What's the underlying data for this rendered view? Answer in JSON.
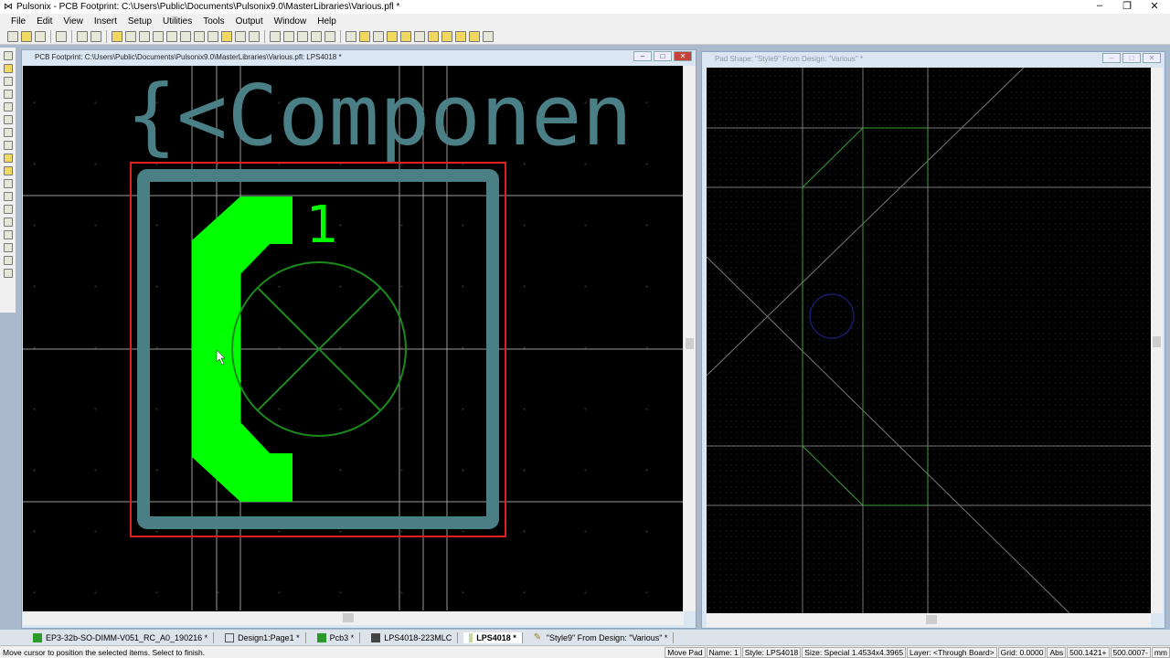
{
  "app": {
    "title": "Pulsonix - PCB Footprint: C:\\Users\\Public\\Documents\\Pulsonix9.0\\MasterLibraries\\Various.pfl *",
    "controls": [
      "–",
      "❐",
      "✕"
    ]
  },
  "menu": [
    "File",
    "Edit",
    "View",
    "Insert",
    "Setup",
    "Utilities",
    "Tools",
    "Output",
    "Window",
    "Help"
  ],
  "left_window": {
    "title": "PCB Footprint: C:\\Users\\Public\\Documents\\Pulsonix9.0\\MasterLibraries\\Various.pfl: LPS4018 *",
    "component_text": "{<Componen",
    "pad_number": "1"
  },
  "right_window": {
    "title": "Pad Shape: \"Style9\"  From Design: \"Various\" *"
  },
  "tabs": [
    {
      "label": "EP3-32b-SO-DIMM-V051_RC_A0_190216 *",
      "icon": "pcb-icon"
    },
    {
      "label": "Design1:Page1 *",
      "icon": "schematic-icon"
    },
    {
      "label": "Pcb3 *",
      "icon": "pcb-icon"
    },
    {
      "label": "LPS4018-223MLC",
      "icon": "footprint-icon"
    },
    {
      "label": "LPS4018 *",
      "icon": "footprint-icon",
      "active": true
    },
    {
      "label": "\"Style9\"  From Design: \"Various\" *",
      "icon": "pad-style-icon"
    }
  ],
  "status": {
    "message": "Move cursor to position the selected items. Select to finish.",
    "cells": [
      "Move Pad",
      "Name: 1",
      "Style: LPS4018",
      "Size: Special 1.4534x4.3965",
      "Layer: <Through Board>",
      "Grid: 0.0000",
      "Abs",
      "500.1421+",
      "500.0007-",
      "mm"
    ]
  },
  "colors": {
    "canvas": "#000000",
    "silk": "#4a7f86",
    "pad": "#00ff00",
    "outline": "#e02020",
    "circle": "#1a8a1a"
  }
}
